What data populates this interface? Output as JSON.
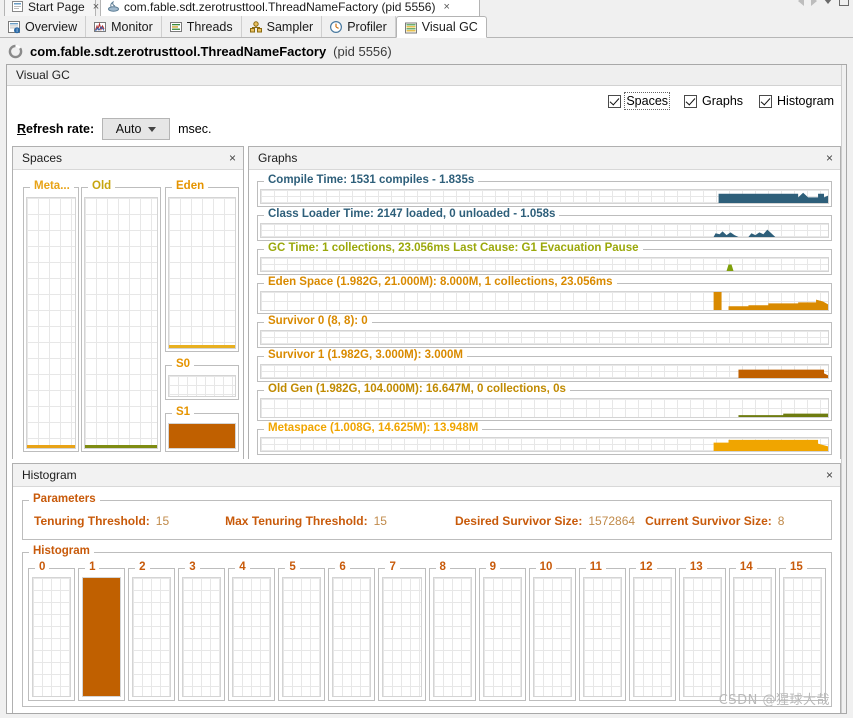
{
  "window": {
    "doc_tabs": [
      {
        "label": "Start Page",
        "icon": "start-page-icon",
        "active": false
      },
      {
        "label": "com.fable.sdt.zerotrusttool.ThreadNameFactory (pid 5556)",
        "icon": "jvm-icon",
        "active": true
      }
    ],
    "close_glyph": "×",
    "nav_back": "nav-back-arrow",
    "nav_forward": "nav-forward-arrow"
  },
  "view_tabs": [
    {
      "label": "Overview",
      "icon": "overview-icon",
      "active": false
    },
    {
      "label": "Monitor",
      "icon": "monitor-icon",
      "active": false
    },
    {
      "label": "Threads",
      "icon": "threads-icon",
      "active": false
    },
    {
      "label": "Sampler",
      "icon": "sampler-icon",
      "active": false
    },
    {
      "label": "Profiler",
      "icon": "profiler-clock-icon",
      "active": false
    },
    {
      "label": "Visual GC",
      "icon": "visual-gc-icon",
      "active": true
    }
  ],
  "process": {
    "icon": "process-ring-icon",
    "name": "com.fable.sdt.zerotrusttool.ThreadNameFactory",
    "pid": "(pid 5556)"
  },
  "panel": {
    "title": "Visual GC",
    "checkboxes": [
      {
        "label": "Spaces",
        "checked": true,
        "focused": true
      },
      {
        "label": "Graphs",
        "checked": true,
        "focused": false
      },
      {
        "label": "Histogram",
        "checked": true,
        "focused": false
      }
    ],
    "refresh": {
      "label_prefix": "R",
      "label_rest": "efresh rate:",
      "value": "Auto",
      "unit": "msec."
    }
  },
  "spaces": {
    "title": "Spaces",
    "close": "×",
    "columns": [
      {
        "name": "Meta...",
        "color": "#E8A317",
        "fill_pct": 1.5,
        "fill_color": "#E8A317"
      },
      {
        "name": "Old",
        "color": "#B8A010",
        "fill_pct": 1.2,
        "fill_color": "#7F8C12"
      },
      {
        "name": "Eden",
        "color": "#E59400",
        "fill_pct": 1.0,
        "fill_color": "#E8B020"
      }
    ],
    "survivors": [
      {
        "name": "S0",
        "color": "#E59400",
        "fill_pct": 0,
        "fill_color": "#C06000"
      },
      {
        "name": "S1",
        "color": "#E59400",
        "fill_pct": 100,
        "fill_color": "#C06000"
      }
    ]
  },
  "graphs": {
    "title": "Graphs",
    "close": "×",
    "rows": [
      {
        "label": "Compile Time: 1531 compiles - 1.835s",
        "color": "#2E5F7A",
        "trace": "compile-time-trace"
      },
      {
        "label": "Class Loader Time: 2147 loaded, 0 unloaded - 1.058s",
        "color": "#2E5F7A",
        "trace": "class-loader-time-trace"
      },
      {
        "label": "GC Time: 1 collections, 23.056ms Last Cause: G1 Evacuation Pause",
        "color": "#9BA80B",
        "trace": "gc-time-trace"
      },
      {
        "label": "Eden Space (1.982G, 21.000M): 8.000M, 1 collections, 23.056ms",
        "color": "#D98A00",
        "trace": "eden-space-trace"
      },
      {
        "label": "Survivor 0 (8, 8): 0",
        "color": "#D98A00",
        "trace": "survivor-0-trace"
      },
      {
        "label": "Survivor 1 (1.982G, 3.000M): 3.000M",
        "color": "#D98A00",
        "trace": "survivor-1-trace"
      },
      {
        "label": "Old Gen (1.982G, 104.000M): 16.647M, 0 collections, 0s",
        "color": "#C08A00",
        "trace": "old-gen-trace"
      },
      {
        "label": "Metaspace (1.008G, 14.625M): 13.948M",
        "color": "#F0A500",
        "trace": "metaspace-trace"
      }
    ]
  },
  "histogram_panel": {
    "title": "Histogram",
    "close": "×",
    "parameters": {
      "group_title": "Parameters",
      "items": [
        {
          "label": "Tenuring Threshold:",
          "value": "15"
        },
        {
          "label": "Max Tenuring Threshold:",
          "value": "15"
        },
        {
          "label": "Desired Survivor Size:",
          "value": "1572864"
        },
        {
          "label": "Current Survivor Size:",
          "value": "8"
        }
      ]
    },
    "histogram": {
      "group_title": "Histogram"
    }
  },
  "chart_data": {
    "type": "bar",
    "title": "Histogram",
    "xlabel": "",
    "ylabel": "",
    "categories": [
      "0",
      "1",
      "2",
      "3",
      "4",
      "5",
      "6",
      "7",
      "8",
      "9",
      "10",
      "11",
      "12",
      "13",
      "14",
      "15"
    ],
    "values": [
      0,
      100,
      0,
      0,
      0,
      0,
      0,
      0,
      0,
      0,
      0,
      0,
      0,
      0,
      0,
      0
    ],
    "ylim": [
      0,
      100
    ],
    "bar_color": "#C06000",
    "grid": true,
    "legend": "none"
  },
  "watermark": "CSDN @猩球大哉"
}
